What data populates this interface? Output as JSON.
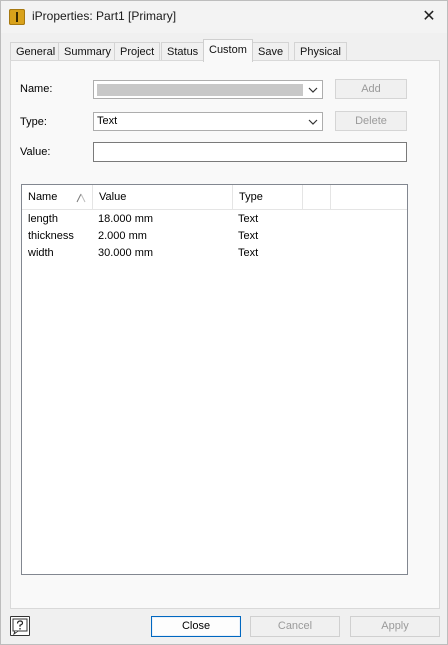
{
  "window": {
    "title": "iProperties: Part1 [Primary]",
    "close_glyph": "✕"
  },
  "tabs": [
    {
      "label": "General"
    },
    {
      "label": "Summary"
    },
    {
      "label": "Project"
    },
    {
      "label": "Status"
    },
    {
      "label": "Custom",
      "active": true
    },
    {
      "label": "Save"
    },
    {
      "label": "Physical"
    }
  ],
  "form": {
    "name_label": "Name:",
    "name_value": "",
    "type_label": "Type:",
    "type_value": "Text",
    "value_label": "Value:",
    "value_value": "",
    "add_label": "Add",
    "delete_label": "Delete"
  },
  "table": {
    "columns": [
      "Name",
      "Value",
      "Type"
    ],
    "rows": [
      {
        "name": "length",
        "value": "18.000 mm",
        "type": "Text"
      },
      {
        "name": "thickness",
        "value": "2.000 mm",
        "type": "Text"
      },
      {
        "name": "width",
        "value": "30.000 mm",
        "type": "Text"
      }
    ]
  },
  "footer": {
    "close_label": "Close",
    "cancel_label": "Cancel",
    "apply_label": "Apply"
  },
  "colors": {
    "accent": "#0067c0",
    "app_icon": "#d9a21b"
  },
  "icons": {
    "app": "inventor-app-icon",
    "close": "close-icon",
    "dropdown": "chevron-down-icon",
    "sort": "sort-icon",
    "help": "help-icon"
  }
}
